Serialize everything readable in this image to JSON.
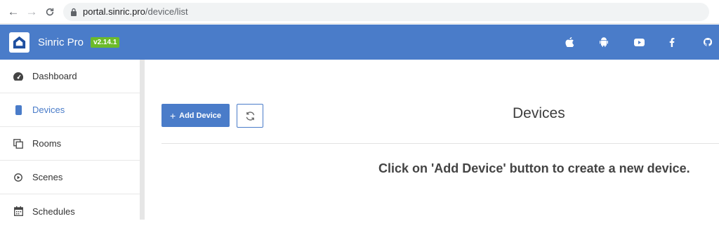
{
  "browser": {
    "url_host": "portal.sinric.pro",
    "url_path": "/device/list"
  },
  "header": {
    "brand": "Sinric Pro",
    "version": "v2.14.1",
    "social_icons": [
      "apple-icon",
      "android-icon",
      "youtube-icon",
      "facebook-icon",
      "github-icon"
    ]
  },
  "sidebar": {
    "items": [
      {
        "label": "Dashboard",
        "icon": "dashboard-icon"
      },
      {
        "label": "Devices",
        "icon": "device-icon",
        "active": true
      },
      {
        "label": "Rooms",
        "icon": "rooms-icon"
      },
      {
        "label": "Scenes",
        "icon": "scenes-icon"
      },
      {
        "label": "Schedules",
        "icon": "calendar-icon"
      }
    ]
  },
  "main": {
    "add_button": "Add Device",
    "title": "Devices",
    "empty_message": "Click on 'Add Device' button to create a new device."
  },
  "colors": {
    "accent": "#4a7cc9",
    "version_badge": "#6cbb2a"
  }
}
